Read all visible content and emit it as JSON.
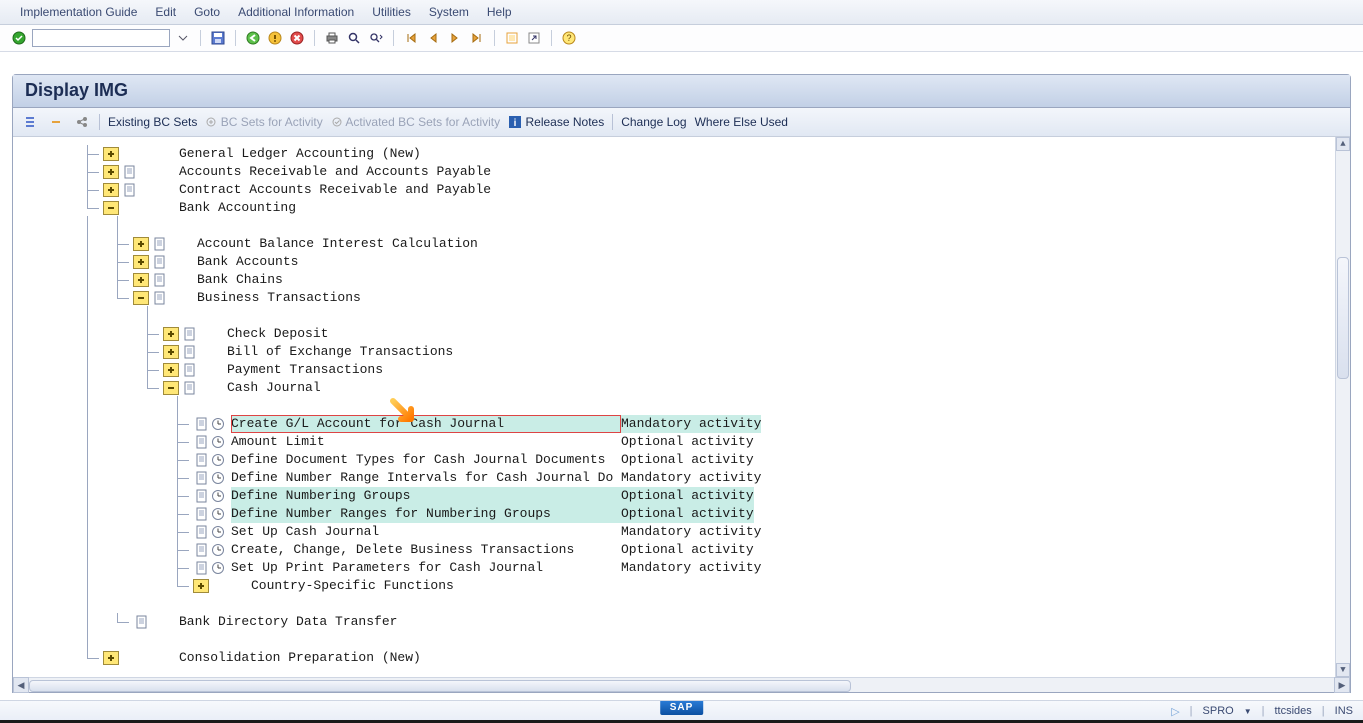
{
  "menubar": {
    "items": [
      "Implementation Guide",
      "Edit",
      "Goto",
      "Additional Information",
      "Utilities",
      "System",
      "Help"
    ]
  },
  "header": {
    "title": "Display IMG"
  },
  "appbar": {
    "existing": "Existing BC Sets",
    "bc_activity": "BC Sets for Activity",
    "activated": "Activated BC Sets for Activity",
    "release_notes": "Release Notes",
    "change_log": "Change Log",
    "where_else": "Where Else Used"
  },
  "tree": {
    "level1": [
      {
        "label": "General Ledger Accounting (New)",
        "expand": "plus",
        "doc": false
      },
      {
        "label": "Accounts Receivable and Accounts Payable",
        "expand": "plus",
        "doc": true
      },
      {
        "label": "Contract Accounts Receivable and Payable",
        "expand": "plus",
        "doc": true
      },
      {
        "label": "Bank Accounting",
        "expand": "minus",
        "doc": false
      }
    ],
    "bank_children": [
      {
        "label": "Account Balance Interest Calculation",
        "expand": "plus",
        "doc": true
      },
      {
        "label": "Bank Accounts",
        "expand": "plus",
        "doc": true
      },
      {
        "label": "Bank Chains",
        "expand": "plus",
        "doc": true
      },
      {
        "label": "Business Transactions",
        "expand": "minus",
        "doc": true
      }
    ],
    "biz_children": [
      {
        "label": "Check Deposit",
        "expand": "plus",
        "doc": true
      },
      {
        "label": "Bill of Exchange Transactions",
        "expand": "plus",
        "doc": true
      },
      {
        "label": "Payment Transactions",
        "expand": "plus",
        "doc": true
      },
      {
        "label": "Cash Journal",
        "expand": "minus",
        "doc": true
      }
    ],
    "cash_children": [
      {
        "label": "Create G/L Account for Cash Journal",
        "activity": "Mandatory activity",
        "hl": "row-red"
      },
      {
        "label": "Amount Limit",
        "activity": "Optional activity",
        "hl": "none"
      },
      {
        "label": "Define Document Types for Cash Journal Documents ",
        "activity": "Optional activity",
        "hl": "none"
      },
      {
        "label": "Define Number Range Intervals for Cash Journal Do",
        "activity": "Mandatory activity",
        "hl": "none"
      },
      {
        "label": "Define Numbering Groups",
        "activity": "Optional activity",
        "hl": "act"
      },
      {
        "label": "Define Number Ranges for Numbering Groups",
        "activity": "Optional activity",
        "hl": "act"
      },
      {
        "label": "Set Up Cash Journal",
        "activity": "Mandatory activity",
        "hl": "none"
      },
      {
        "label": "Create, Change, Delete Business Transactions",
        "activity": "Optional activity",
        "hl": "none"
      },
      {
        "label": "Set Up Print Parameters for Cash Journal",
        "activity": "Mandatory activity",
        "hl": "none"
      }
    ],
    "cash_last": {
      "label": "Country-Specific Functions",
      "expand": "plus"
    },
    "bank_last": {
      "label": "Bank Directory Data Transfer"
    },
    "last": {
      "label": "Consolidation Preparation (New)"
    }
  },
  "status": {
    "tcode": "SPRO",
    "user": "ttcsides",
    "mode": "INS",
    "logo": "SAP"
  }
}
